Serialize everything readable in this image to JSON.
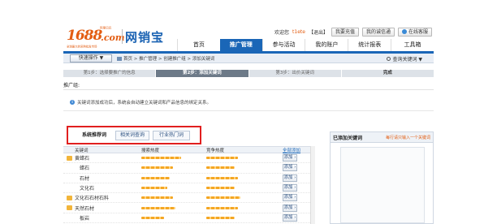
{
  "header": {
    "logo_1688": "1688",
    "logo_com": ".com",
    "logo_tag": "阿里巴巴",
    "logo_sub": "全球最大的采购批发市场",
    "brand_name": "网销宝",
    "welcome": "欢迎您",
    "username": "t1ete",
    "logout": "【退出】",
    "recharge_button": "我要充值",
    "company_button": "我的诚信通",
    "service_button": "在线客服"
  },
  "nav": {
    "tabs": [
      "首页",
      "推广管理",
      "参与活动",
      "我的账户",
      "统计报表",
      "工具箱"
    ]
  },
  "toolbar": {
    "quick_action": "快速操作 ▼",
    "breadcrumb": "首页 > 推广管理 > 创建推广组 > 添加关键词",
    "search_help": "查询关键词 ▼"
  },
  "steps": [
    "第1步：选择要推广的信息",
    "第2步：添加关键词",
    "第3步：出价关键词",
    "完成"
  ],
  "promo_group_label": "推广组:",
  "info_message": "关键词添加成功后，系统会自动建立关键词和产品信息的绑定关系。",
  "keyword_tabs": [
    "系统推荐词",
    "相关词查询",
    "行业热门词"
  ],
  "table": {
    "headers": {
      "keyword": "关键词",
      "search": "搜索热度",
      "competition": "竞争热度",
      "add_all": "全部添加"
    },
    "add_label": "添加 ›",
    "rows": [
      {
        "keyword": "黄蜡石",
        "folder": true,
        "indent": false,
        "search_level": 0.7,
        "comp_level": 0.55
      },
      {
        "keyword": "蜡石",
        "folder": false,
        "indent": true,
        "search_level": 0.55,
        "comp_level": 0.5
      },
      {
        "keyword": "石材",
        "folder": false,
        "indent": true,
        "search_level": 0.5,
        "comp_level": 0.55
      },
      {
        "keyword": "文化石",
        "folder": false,
        "indent": true,
        "search_level": 0.45,
        "comp_level": 0.5
      },
      {
        "keyword": "文化石石材石料",
        "folder": true,
        "indent": false,
        "search_level": 0.55,
        "comp_level": 0.6
      },
      {
        "keyword": "天然石材",
        "folder": true,
        "indent": false,
        "search_level": 0.6,
        "comp_level": 0.55
      },
      {
        "keyword": "板岩",
        "folder": false,
        "indent": true,
        "search_level": 0.4,
        "comp_level": 0.5
      },
      {
        "keyword": "大山石",
        "folder": false,
        "indent": true,
        "search_level": 0.45,
        "comp_level": 0.45
      }
    ]
  },
  "right_panel": {
    "title": "已添加关键词",
    "hint": "每行请只输入一个关键词"
  }
}
